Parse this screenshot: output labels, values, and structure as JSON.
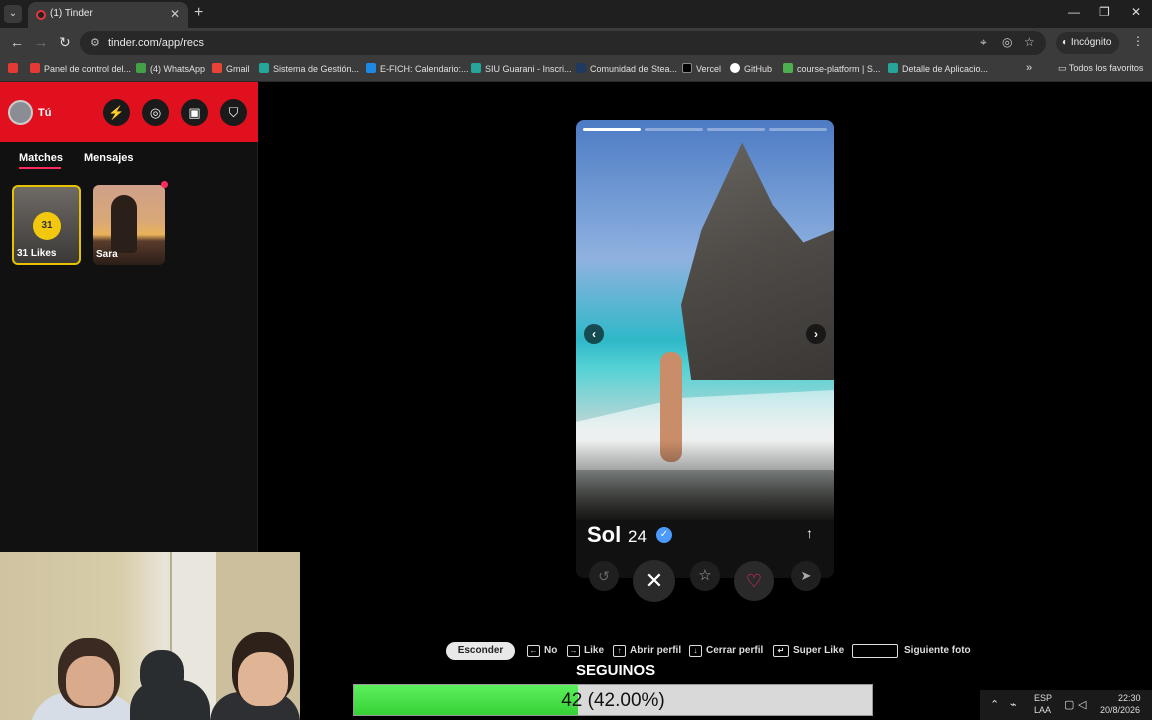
{
  "browser": {
    "tab_title": "(1) Tinder",
    "url": "tinder.com/app/recs",
    "incognito_label": "Incógnito",
    "bookmarks": [
      {
        "label": "Panel de control del...",
        "color": "#e53935"
      },
      {
        "label": "(4) WhatsApp",
        "color": "#43a047"
      },
      {
        "label": "Gmail",
        "color": "#ea4335"
      },
      {
        "label": "Sistema de Gestión...",
        "color": "#26a69a"
      },
      {
        "label": "E-FICH: Calendario:...",
        "color": "#1e88e5"
      },
      {
        "label": "SIU Guarani - Inscri...",
        "color": "#26a69a"
      },
      {
        "label": "Comunidad de Stea...",
        "color": "#1e3a5f"
      },
      {
        "label": "Vercel",
        "color": "#000000"
      },
      {
        "label": "GitHub",
        "color": "#ffffff"
      },
      {
        "label": "course-platform | S...",
        "color": "#4caf50"
      },
      {
        "label": "Detalle de Aplicacio...",
        "color": "#26a69a"
      }
    ],
    "all_bookmarks_label": "Todos los favoritos"
  },
  "sidebar": {
    "user_label": "Tú",
    "tabs": [
      "Matches",
      "Mensajes"
    ],
    "likes_count": "31",
    "likes_label": "31 Likes",
    "match_name": "Sara"
  },
  "profile": {
    "name": "Sol",
    "age": "24",
    "photo_count": 4,
    "active_photo": 1
  },
  "hints": {
    "hide_label": "Esconder",
    "items": [
      "No",
      "Like",
      "Abrir perfil",
      "Cerrar perfil",
      "Super Like",
      "Siguiente foto"
    ]
  },
  "overlay": {
    "follow_label": "SEGUINOS",
    "progress_value": 42,
    "progress_fraction": 0.42,
    "progress_text": "42 (42.00%)"
  },
  "tray": {
    "lang_top": "ESP",
    "lang_bottom": "LAA",
    "time": "22:30",
    "date": "20/8/2026"
  },
  "colors": {
    "tinder_red": "#e0101e",
    "like_pink": "#fd2a5c",
    "progress_green": "#36d136",
    "likes_gold": "#f2c80f"
  }
}
